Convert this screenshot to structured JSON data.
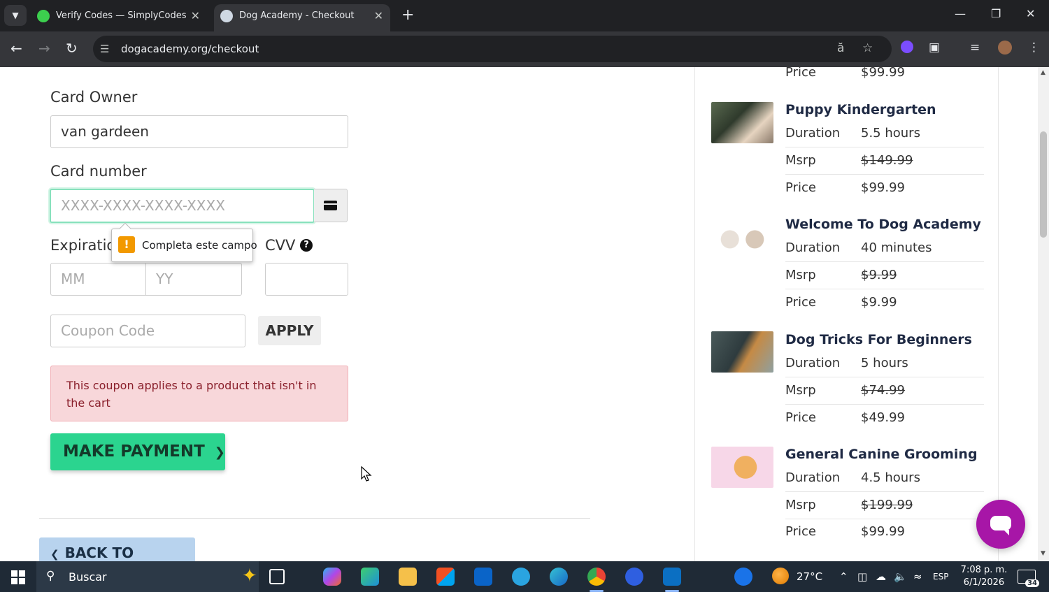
{
  "browser": {
    "tabs": [
      {
        "title": "Verify Codes — SimplyCodes",
        "active": false
      },
      {
        "title": "Dog Academy - Checkout",
        "active": true
      }
    ],
    "url": "dogacademy.org/checkout"
  },
  "payment_form": {
    "card_owner_label": "Card Owner",
    "card_owner_value": "van gardeen",
    "card_number_label": "Card number",
    "card_number_placeholder": "XXXX-XXXX-XXXX-XXXX",
    "validation_tooltip": "Completa este campo",
    "expiration_label": "Expiratio",
    "month_placeholder": "MM",
    "year_placeholder": "YY",
    "cvv_label": "CVV",
    "cvv_help_icon": "question-circle-icon",
    "coupon_placeholder": "Coupon Code",
    "apply_label": "APPLY",
    "coupon_error": "This coupon applies to a product that isn't in the cart",
    "make_payment_label": "MAKE PAYMENT",
    "back_label": "BACK TO BILLING"
  },
  "cart": {
    "top_partial": {
      "price_label": "Price",
      "price_value": "$99.99"
    },
    "items": [
      {
        "title": "Puppy Kindergarten",
        "duration_label": "Duration",
        "duration": "5.5 hours",
        "msrp_label": "Msrp",
        "msrp": "$149.99",
        "price_label": "Price",
        "price": "$99.99"
      },
      {
        "title": "Welcome To Dog Academy",
        "duration_label": "Duration",
        "duration": "40 minutes",
        "msrp_label": "Msrp",
        "msrp": "$9.99",
        "price_label": "Price",
        "price": "$9.99"
      },
      {
        "title": "Dog Tricks For Beginners",
        "duration_label": "Duration",
        "duration": "5 hours",
        "msrp_label": "Msrp",
        "msrp": "$74.99",
        "price_label": "Price",
        "price": "$49.99"
      },
      {
        "title": "General Canine Grooming",
        "duration_label": "Duration",
        "duration": "4.5 hours",
        "msrp_label": "Msrp",
        "msrp": "$199.99",
        "price_label": "Price",
        "price": "$99.99"
      }
    ]
  },
  "taskbar": {
    "search_placeholder": "Buscar",
    "weather": "27°C",
    "language": "ESP",
    "time": "7:08 p. m.",
    "date": "6/1/2026",
    "notifications": "34"
  },
  "colors": {
    "accent_green": "#2bd48f",
    "error_bg": "#f8d7da",
    "chat_purple": "#a716a7",
    "back_button_blue": "#b8d3ee"
  }
}
